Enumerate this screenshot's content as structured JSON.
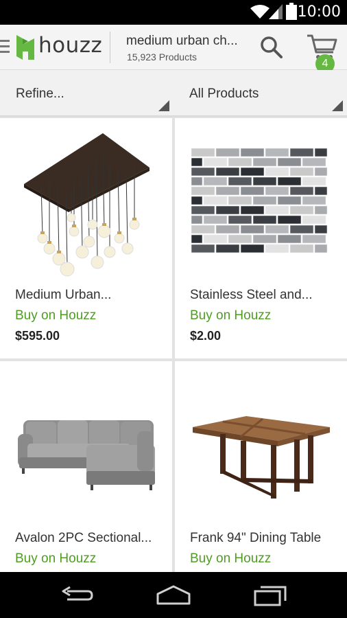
{
  "status_bar": {
    "time": "10:00",
    "icons": [
      "wifi-icon",
      "cell-signal-icon",
      "battery-icon"
    ]
  },
  "app_bar": {
    "logo_text": "houzz",
    "search_query": "medium urban ch...",
    "product_count": "15,923 Products",
    "cart_count": "4",
    "icons": [
      "menu-icon",
      "houzz-logo-icon",
      "search-icon",
      "cart-icon"
    ]
  },
  "filters": {
    "refine_label": "Refine...",
    "category_label": "All Products"
  },
  "products": [
    {
      "title": "Medium Urban...",
      "buy_label": "Buy on Houzz",
      "price": "$595.00"
    },
    {
      "title": "Stainless Steel and...",
      "buy_label": "Buy on Houzz",
      "price": "$2.00"
    },
    {
      "title": "Avalon 2PC Sectional...",
      "buy_label": "Buy on Houzz",
      "price": ""
    },
    {
      "title": "Frank 94\" Dining Table",
      "buy_label": "Buy on Houzz",
      "price": ""
    }
  ],
  "nav_bar": {
    "icons": [
      "back-icon",
      "home-icon",
      "recent-apps-icon"
    ]
  },
  "colors": {
    "brand_green": "#65b841",
    "buy_link_green": "#4e9d21",
    "app_bar_bg": "#f4f4f4"
  }
}
